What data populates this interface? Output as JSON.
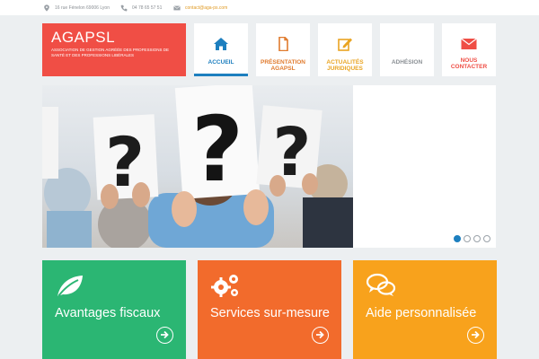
{
  "topbar": {
    "address": "16 rue Fénelon 69006 Lyon",
    "phone": "04 78 65 57 51",
    "email": "contact@aga-ps.com"
  },
  "logo": {
    "name": "AGAPSL",
    "tagline": "ASSOCIATION DE GESTION AGRÉÉE DES PROFESSIONS DE SANTÉ ET DES PROFESSIONS LIBÉRALES"
  },
  "nav": [
    {
      "label": "ACCUEIL",
      "icon": "home-icon",
      "color": "#1d7fbf",
      "active": true
    },
    {
      "label": "PRÉSENTATION AGAPSL",
      "icon": "document-icon",
      "color": "#e07b2e",
      "active": false
    },
    {
      "label": "ACTUALITÉS JURIDIQUES",
      "icon": "edit-icon",
      "color": "#e9a422",
      "active": false
    },
    {
      "label": "ADHÉSION",
      "icon": "",
      "color": "#8a8f94",
      "active": false
    },
    {
      "label": "NOUS CONTACTER",
      "icon": "mail-icon",
      "color": "#ef4e45",
      "active": false
    }
  ],
  "slider": {
    "slide_count": 4,
    "active_slide": 1,
    "sign_text": "?"
  },
  "tiles": [
    {
      "title": "Avantages fiscaux",
      "icon": "leaf-icon",
      "color": "#2bb673"
    },
    {
      "title": "Services sur-mesure",
      "icon": "gears-icon",
      "color": "#f26b2c"
    },
    {
      "title": "Aide personnalisée",
      "icon": "chat-icon",
      "color": "#f8a21c"
    }
  ],
  "colors": {
    "accent": "#1d7fbf",
    "logo_bg": "#f04e45",
    "page_bg": "#eceff1"
  }
}
